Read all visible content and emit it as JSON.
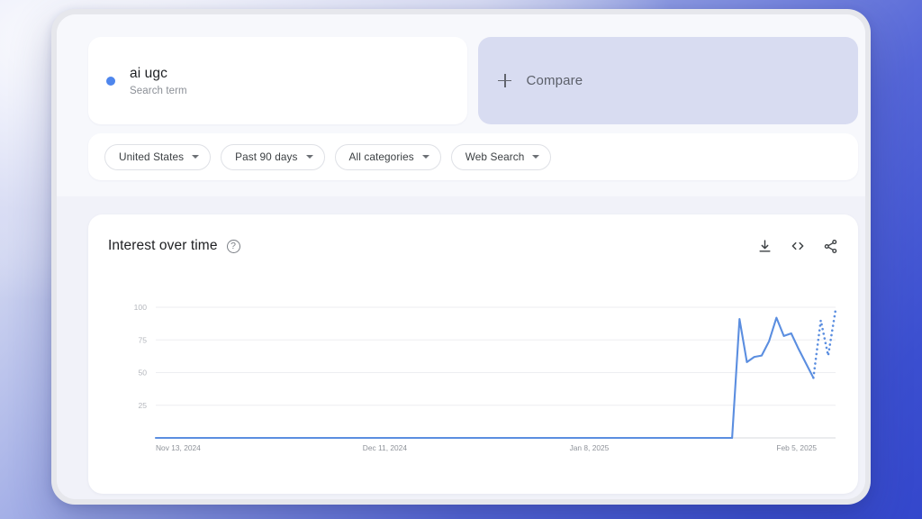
{
  "search_term": {
    "title": "ai ugc",
    "subtitle": "Search term",
    "dot_color": "#4e86ed"
  },
  "compare": {
    "label": "Compare",
    "plus_icon": "plus-icon",
    "background_color": "#d8dcf1"
  },
  "filters": [
    {
      "label": "United States",
      "icon": "chevron-down-icon"
    },
    {
      "label": "Past 90 days",
      "icon": "chevron-down-icon"
    },
    {
      "label": "All categories",
      "icon": "chevron-down-icon"
    },
    {
      "label": "Web Search",
      "icon": "chevron-down-icon"
    }
  ],
  "chart_card": {
    "title": "Interest over time",
    "help_icon_glyph": "?",
    "actions": [
      {
        "name": "download-icon"
      },
      {
        "name": "embed-code-icon"
      },
      {
        "name": "share-icon"
      }
    ]
  },
  "chart_data": {
    "type": "line",
    "title": "Interest over time",
    "xlabel": "",
    "ylabel": "",
    "ylim": [
      0,
      100
    ],
    "yticks": [
      25,
      50,
      75,
      100
    ],
    "ytick_labels": [
      "25",
      "50",
      "75",
      "100"
    ],
    "grid": true,
    "legend_position": "none",
    "series_color": "#5b8ee0",
    "xtick_labels": [
      "Nov 13, 2024",
      "Dec 11, 2024",
      "Jan 8, 2025",
      "Feb 5, 2025"
    ],
    "xtick_positions": [
      0,
      28,
      56,
      84
    ],
    "x_range": [
      0,
      92
    ],
    "annotation": "Trailing dotted segment indicates partial/incomplete data",
    "series": [
      {
        "name": "ai ugc",
        "x": [
          0,
          2,
          4,
          6,
          8,
          10,
          12,
          14,
          16,
          18,
          20,
          22,
          24,
          26,
          28,
          30,
          32,
          34,
          36,
          38,
          40,
          42,
          44,
          46,
          48,
          50,
          52,
          54,
          56,
          58,
          60,
          62,
          64,
          66,
          68,
          70,
          72,
          74,
          76,
          78,
          79,
          80,
          81,
          82,
          83,
          84,
          85,
          86,
          87,
          88,
          89
        ],
        "values": [
          0,
          0,
          0,
          0,
          0,
          0,
          0,
          0,
          0,
          0,
          0,
          0,
          0,
          0,
          0,
          0,
          0,
          0,
          0,
          0,
          0,
          0,
          0,
          0,
          0,
          0,
          0,
          0,
          0,
          0,
          0,
          0,
          0,
          0,
          0,
          0,
          0,
          0,
          0,
          0,
          91,
          58,
          62,
          63,
          74,
          92,
          78,
          80,
          68,
          57,
          46
        ],
        "partial_x": [
          89,
          90,
          91,
          92
        ],
        "partial_values": [
          46,
          90,
          63,
          98
        ]
      }
    ]
  }
}
